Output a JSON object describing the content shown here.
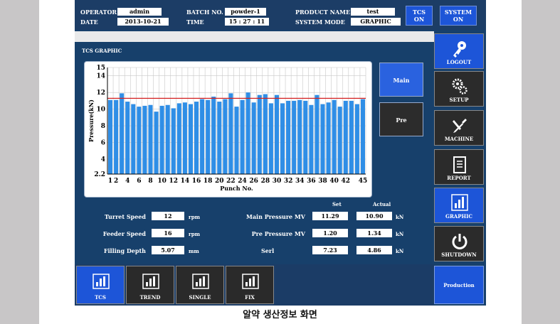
{
  "header": {
    "operator_label": "OPERATOR",
    "operator_value": "admin",
    "date_label": "DATE",
    "date_value": "2013-10-21",
    "batch_label": "BATCH NO.",
    "batch_value": "powder-1",
    "time_label": "TIME",
    "time_value": "15 : 27 : 11",
    "product_label": "PRODUCT NAME",
    "product_value": "test",
    "mode_label": "SYSTEM MODE",
    "mode_value": "GRAPHIC",
    "tcs_btn": [
      "TCS",
      "ON"
    ],
    "system_btn": [
      "SYSTEM",
      "ON"
    ]
  },
  "screen_title": "TCS GRAPHIC",
  "chart_data": {
    "type": "bar",
    "title": "",
    "xlabel": "Punch No.",
    "ylabel": "Pressure(kN)",
    "ylim": [
      2.2,
      15
    ],
    "yticks": [
      "2.2",
      "4",
      "6",
      "8",
      "10",
      "12",
      "14",
      "15"
    ],
    "xticks": [
      "1",
      "2",
      "4",
      "6",
      "8",
      "10",
      "12",
      "14",
      "16",
      "18",
      "20",
      "22",
      "24",
      "26",
      "28",
      "30",
      "32",
      "34",
      "36",
      "38",
      "40",
      "42",
      "45"
    ],
    "reference_line": 11.3,
    "colors": {
      "bar": "#2f8ee6",
      "line": "#d42020",
      "grid": "#c8c8c8"
    },
    "x": [
      1,
      2,
      3,
      4,
      5,
      6,
      7,
      8,
      9,
      10,
      11,
      12,
      13,
      14,
      15,
      16,
      17,
      18,
      19,
      20,
      21,
      22,
      23,
      24,
      25,
      26,
      27,
      28,
      29,
      30,
      31,
      32,
      33,
      34,
      35,
      36,
      37,
      38,
      39,
      40,
      41,
      42,
      43,
      44,
      45
    ],
    "values": [
      11.1,
      11.1,
      11.9,
      10.9,
      10.6,
      10.3,
      10.4,
      10.5,
      9.7,
      10.4,
      10.5,
      10.1,
      10.7,
      10.8,
      10.6,
      10.9,
      11.2,
      11.1,
      11.5,
      10.9,
      11.2,
      11.9,
      10.3,
      11.1,
      12.0,
      10.8,
      11.7,
      11.8,
      10.7,
      11.7,
      10.7,
      11.0,
      11.0,
      11.1,
      11.0,
      10.5,
      11.7,
      10.6,
      10.8,
      11.1,
      10.3,
      11.0,
      11.0,
      10.6,
      11.2
    ]
  },
  "toggles": {
    "main": "Main",
    "pre": "Pre"
  },
  "menu": [
    "LOGOUT",
    "SETUP",
    "MACHINE",
    "REPORT",
    "GRAPHIC",
    "SHUTDOWN"
  ],
  "readouts": {
    "set_header": "Set",
    "actual_header": "Actual",
    "turret_label": "Turret Speed",
    "turret_value": "12",
    "turret_unit": "rpm",
    "feeder_label": "Feeder Speed",
    "feeder_value": "16",
    "feeder_unit": "rpm",
    "filling_label": "Filling Depth",
    "filling_value": "5.07",
    "filling_unit": "mm",
    "main_label": "Main Pressure MV",
    "main_set": "11.29",
    "main_actual": "10.90",
    "main_unit": "kN",
    "pre_label": "Pre Pressure MV",
    "pre_set": "1.20",
    "pre_actual": "1.34",
    "pre_unit": "kN",
    "serl_label": "Serl",
    "serl_set": "7.23",
    "serl_actual": "4.86",
    "serl_unit": "kN"
  },
  "tabs": [
    "TCS",
    "TREND",
    "SINGLE",
    "FIX"
  ],
  "production": "Production",
  "caption": "알약 생산정보 화면"
}
